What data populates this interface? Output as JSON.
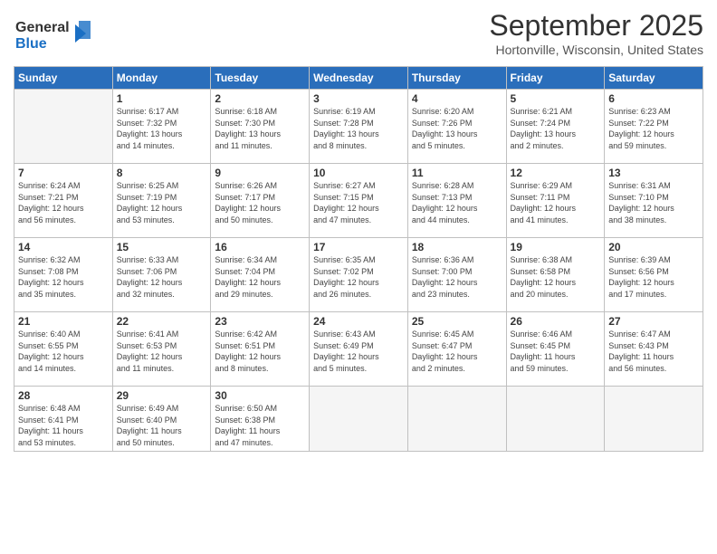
{
  "header": {
    "logo_line1": "General",
    "logo_line2": "Blue",
    "month": "September 2025",
    "location": "Hortonville, Wisconsin, United States"
  },
  "weekdays": [
    "Sunday",
    "Monday",
    "Tuesday",
    "Wednesday",
    "Thursday",
    "Friday",
    "Saturday"
  ],
  "weeks": [
    [
      {
        "day": "",
        "info": ""
      },
      {
        "day": "1",
        "info": "Sunrise: 6:17 AM\nSunset: 7:32 PM\nDaylight: 13 hours\nand 14 minutes."
      },
      {
        "day": "2",
        "info": "Sunrise: 6:18 AM\nSunset: 7:30 PM\nDaylight: 13 hours\nand 11 minutes."
      },
      {
        "day": "3",
        "info": "Sunrise: 6:19 AM\nSunset: 7:28 PM\nDaylight: 13 hours\nand 8 minutes."
      },
      {
        "day": "4",
        "info": "Sunrise: 6:20 AM\nSunset: 7:26 PM\nDaylight: 13 hours\nand 5 minutes."
      },
      {
        "day": "5",
        "info": "Sunrise: 6:21 AM\nSunset: 7:24 PM\nDaylight: 13 hours\nand 2 minutes."
      },
      {
        "day": "6",
        "info": "Sunrise: 6:23 AM\nSunset: 7:22 PM\nDaylight: 12 hours\nand 59 minutes."
      }
    ],
    [
      {
        "day": "7",
        "info": "Sunrise: 6:24 AM\nSunset: 7:21 PM\nDaylight: 12 hours\nand 56 minutes."
      },
      {
        "day": "8",
        "info": "Sunrise: 6:25 AM\nSunset: 7:19 PM\nDaylight: 12 hours\nand 53 minutes."
      },
      {
        "day": "9",
        "info": "Sunrise: 6:26 AM\nSunset: 7:17 PM\nDaylight: 12 hours\nand 50 minutes."
      },
      {
        "day": "10",
        "info": "Sunrise: 6:27 AM\nSunset: 7:15 PM\nDaylight: 12 hours\nand 47 minutes."
      },
      {
        "day": "11",
        "info": "Sunrise: 6:28 AM\nSunset: 7:13 PM\nDaylight: 12 hours\nand 44 minutes."
      },
      {
        "day": "12",
        "info": "Sunrise: 6:29 AM\nSunset: 7:11 PM\nDaylight: 12 hours\nand 41 minutes."
      },
      {
        "day": "13",
        "info": "Sunrise: 6:31 AM\nSunset: 7:10 PM\nDaylight: 12 hours\nand 38 minutes."
      }
    ],
    [
      {
        "day": "14",
        "info": "Sunrise: 6:32 AM\nSunset: 7:08 PM\nDaylight: 12 hours\nand 35 minutes."
      },
      {
        "day": "15",
        "info": "Sunrise: 6:33 AM\nSunset: 7:06 PM\nDaylight: 12 hours\nand 32 minutes."
      },
      {
        "day": "16",
        "info": "Sunrise: 6:34 AM\nSunset: 7:04 PM\nDaylight: 12 hours\nand 29 minutes."
      },
      {
        "day": "17",
        "info": "Sunrise: 6:35 AM\nSunset: 7:02 PM\nDaylight: 12 hours\nand 26 minutes."
      },
      {
        "day": "18",
        "info": "Sunrise: 6:36 AM\nSunset: 7:00 PM\nDaylight: 12 hours\nand 23 minutes."
      },
      {
        "day": "19",
        "info": "Sunrise: 6:38 AM\nSunset: 6:58 PM\nDaylight: 12 hours\nand 20 minutes."
      },
      {
        "day": "20",
        "info": "Sunrise: 6:39 AM\nSunset: 6:56 PM\nDaylight: 12 hours\nand 17 minutes."
      }
    ],
    [
      {
        "day": "21",
        "info": "Sunrise: 6:40 AM\nSunset: 6:55 PM\nDaylight: 12 hours\nand 14 minutes."
      },
      {
        "day": "22",
        "info": "Sunrise: 6:41 AM\nSunset: 6:53 PM\nDaylight: 12 hours\nand 11 minutes."
      },
      {
        "day": "23",
        "info": "Sunrise: 6:42 AM\nSunset: 6:51 PM\nDaylight: 12 hours\nand 8 minutes."
      },
      {
        "day": "24",
        "info": "Sunrise: 6:43 AM\nSunset: 6:49 PM\nDaylight: 12 hours\nand 5 minutes."
      },
      {
        "day": "25",
        "info": "Sunrise: 6:45 AM\nSunset: 6:47 PM\nDaylight: 12 hours\nand 2 minutes."
      },
      {
        "day": "26",
        "info": "Sunrise: 6:46 AM\nSunset: 6:45 PM\nDaylight: 11 hours\nand 59 minutes."
      },
      {
        "day": "27",
        "info": "Sunrise: 6:47 AM\nSunset: 6:43 PM\nDaylight: 11 hours\nand 56 minutes."
      }
    ],
    [
      {
        "day": "28",
        "info": "Sunrise: 6:48 AM\nSunset: 6:41 PM\nDaylight: 11 hours\nand 53 minutes."
      },
      {
        "day": "29",
        "info": "Sunrise: 6:49 AM\nSunset: 6:40 PM\nDaylight: 11 hours\nand 50 minutes."
      },
      {
        "day": "30",
        "info": "Sunrise: 6:50 AM\nSunset: 6:38 PM\nDaylight: 11 hours\nand 47 minutes."
      },
      {
        "day": "",
        "info": ""
      },
      {
        "day": "",
        "info": ""
      },
      {
        "day": "",
        "info": ""
      },
      {
        "day": "",
        "info": ""
      }
    ]
  ]
}
